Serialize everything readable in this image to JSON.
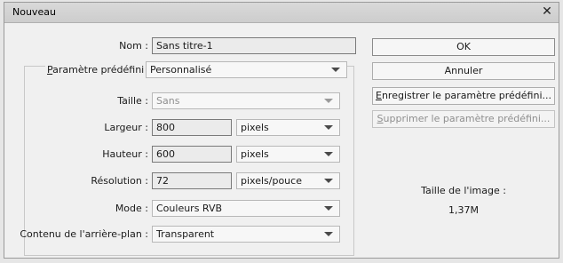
{
  "window": {
    "title": "Nouveau",
    "close_glyph": "✕"
  },
  "form": {
    "name": {
      "label": "Nom :",
      "value": "Sans titre-1"
    },
    "preset": {
      "label_underlined": "P",
      "label_rest": "aramètre prédéfini :",
      "value": "Personnalisé"
    },
    "size": {
      "label": "Taille :",
      "value": "Sans",
      "disabled": true
    },
    "width": {
      "label": "Largeur :",
      "value": "800",
      "unit": "pixels"
    },
    "height": {
      "label": "Hauteur :",
      "value": "600",
      "unit": "pixels"
    },
    "resolution": {
      "label": "Résolution :",
      "value": "72",
      "unit": "pixels/pouce"
    },
    "mode": {
      "label": "Mode :",
      "value": "Couleurs RVB"
    },
    "background": {
      "label": "Contenu de l'arrière-plan :",
      "value": "Transparent"
    }
  },
  "buttons": {
    "ok": "OK",
    "cancel": "Annuler",
    "save_preset_underlined": "E",
    "save_preset_rest": "nregistrer le paramètre prédéfini...",
    "delete_preset_underlined": "S",
    "delete_preset_rest": "upprimer le paramètre prédéfini...",
    "delete_disabled": true
  },
  "image_info": {
    "label": "Taille de l'image :",
    "value": "1,37M"
  },
  "icons": {
    "close": "close-icon",
    "dropdown": "chevron-down-icon"
  }
}
